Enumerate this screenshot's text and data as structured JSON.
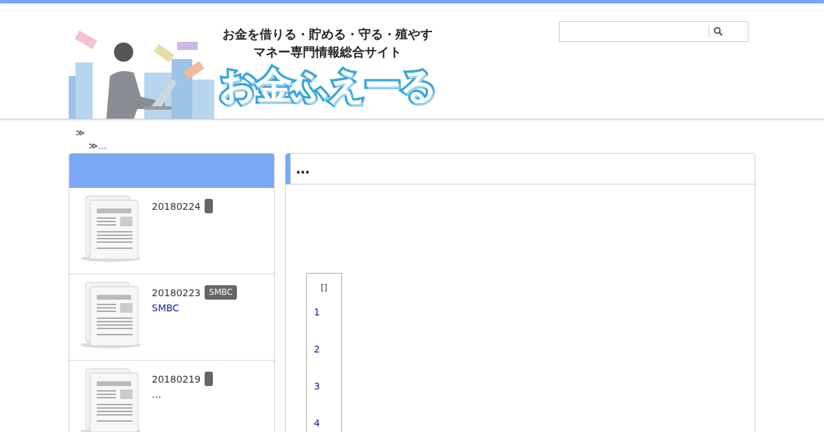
{
  "header": {
    "tagline": [
      "お金を借りる・貯める・守る・殖やす",
      "マネー専門情報総合サイト"
    ],
    "logo": "お金ふえーる"
  },
  "breadcrumbs": [
    "≫",
    "≫…"
  ],
  "sidebar": {
    "items": [
      {
        "date": "20180224"
      },
      {
        "date": "20180223",
        "tag": "SMBC",
        "title": "SMBC"
      },
      {
        "date": "20180219",
        "excerpt": "…"
      }
    ]
  },
  "article": {
    "title": "…",
    "toc": {
      "heading": "[]",
      "items": [
        "1",
        "2",
        "3",
        "4"
      ]
    }
  }
}
